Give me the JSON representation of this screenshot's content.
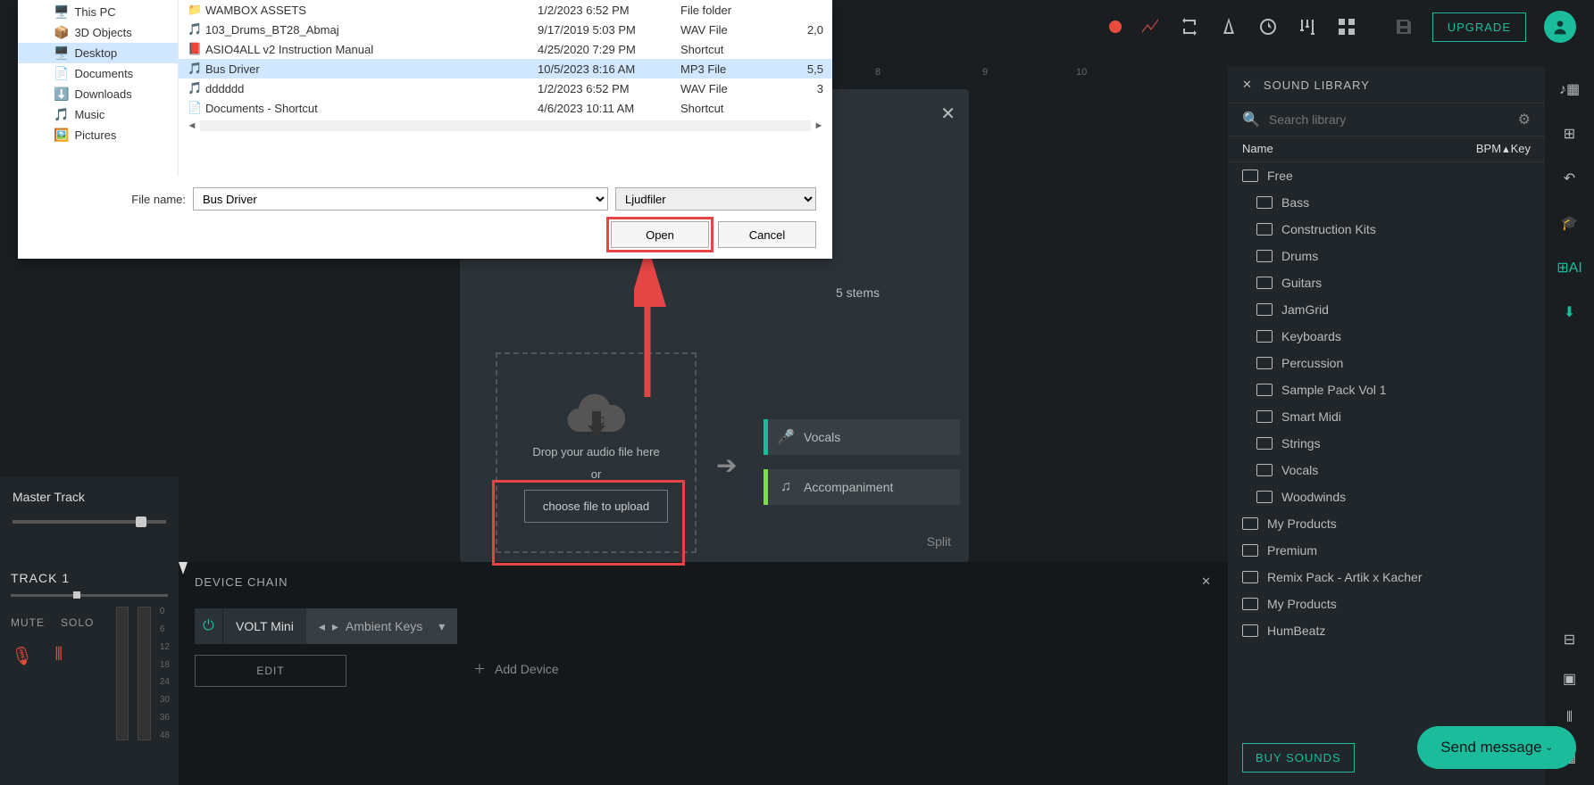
{
  "toolbar": {
    "upgrade": "UPGRADE"
  },
  "fileDialog": {
    "tree": [
      {
        "label": "This PC",
        "icon": "🖥️"
      },
      {
        "label": "3D Objects",
        "icon": "📦"
      },
      {
        "label": "Desktop",
        "icon": "🖥️",
        "selected": true
      },
      {
        "label": "Documents",
        "icon": "📄"
      },
      {
        "label": "Downloads",
        "icon": "⬇️"
      },
      {
        "label": "Music",
        "icon": "🎵"
      },
      {
        "label": "Pictures",
        "icon": "🖼️"
      }
    ],
    "files": [
      {
        "icon": "📁",
        "name": "WAMBOX ASSETS",
        "date": "1/2/2023 6:52 PM",
        "type": "File folder",
        "size": ""
      },
      {
        "icon": "🎵",
        "name": "103_Drums_BT28_Abmaj",
        "date": "9/17/2019 5:03 PM",
        "type": "WAV File",
        "size": "2,0"
      },
      {
        "icon": "📕",
        "name": "ASIO4ALL v2 Instruction Manual",
        "date": "4/25/2020 7:29 PM",
        "type": "Shortcut",
        "size": ""
      },
      {
        "icon": "🎵",
        "name": "Bus Driver",
        "date": "10/5/2023 8:16 AM",
        "type": "MP3 File",
        "size": "5,5",
        "selected": true
      },
      {
        "icon": "🎵",
        "name": "dddddd",
        "date": "1/2/2023 6:52 PM",
        "type": "WAV File",
        "size": "3"
      },
      {
        "icon": "📄",
        "name": "Documents - Shortcut",
        "date": "4/6/2023 10:11 AM",
        "type": "Shortcut",
        "size": ""
      }
    ],
    "fileNameLabel": "File name:",
    "fileNameValue": "Bus Driver",
    "filterValue": "Ljudfiler",
    "openLabel": "Open",
    "cancelLabel": "Cancel"
  },
  "upload": {
    "stemsLabel": "5 stems",
    "dropText": "Drop your audio file here",
    "orText": "or",
    "chooseLabel": "choose file to upload",
    "stems": [
      {
        "label": "Vocals",
        "color": "#1abc9c"
      },
      {
        "label": "Accompaniment",
        "color": "#7fdd4c"
      }
    ],
    "split": "Split"
  },
  "library": {
    "title": "SOUND LIBRARY",
    "searchPlaceholder": "Search library",
    "colName": "Name",
    "colBpm": "BPM",
    "colKey": "Key",
    "items": [
      {
        "label": "Free",
        "indent": false
      },
      {
        "label": "Bass",
        "indent": true
      },
      {
        "label": "Construction Kits",
        "indent": true
      },
      {
        "label": "Drums",
        "indent": true
      },
      {
        "label": "Guitars",
        "indent": true
      },
      {
        "label": "JamGrid",
        "indent": true
      },
      {
        "label": "Keyboards",
        "indent": true
      },
      {
        "label": "Percussion",
        "indent": true
      },
      {
        "label": "Sample Pack Vol 1",
        "indent": true
      },
      {
        "label": "Smart Midi",
        "indent": true
      },
      {
        "label": "Strings",
        "indent": true
      },
      {
        "label": "Vocals",
        "indent": true
      },
      {
        "label": "Woodwinds",
        "indent": true
      },
      {
        "label": "My Products",
        "indent": false
      },
      {
        "label": "Premium",
        "indent": false
      },
      {
        "label": "Remix Pack - Artik x Kacher",
        "indent": false
      },
      {
        "label": "My Products",
        "indent": false
      },
      {
        "label": "HumBeatz",
        "indent": false
      }
    ],
    "buyLabel": "BUY SOUNDS"
  },
  "master": {
    "title": "Master Track"
  },
  "track": {
    "title": "TRACK 1",
    "mute": "MUTE",
    "solo": "SOLO",
    "meterLabels": [
      "0",
      "6",
      "12",
      "18",
      "24",
      "30",
      "36",
      "48"
    ]
  },
  "deviceChain": {
    "title": "DEVICE CHAIN",
    "deviceName": "VOLT Mini",
    "presetName": "Ambient Keys",
    "editLabel": "EDIT",
    "addDevice": "Add Device"
  },
  "ruler": [
    "8",
    "9",
    "10"
  ],
  "sendMessage": "Send message"
}
